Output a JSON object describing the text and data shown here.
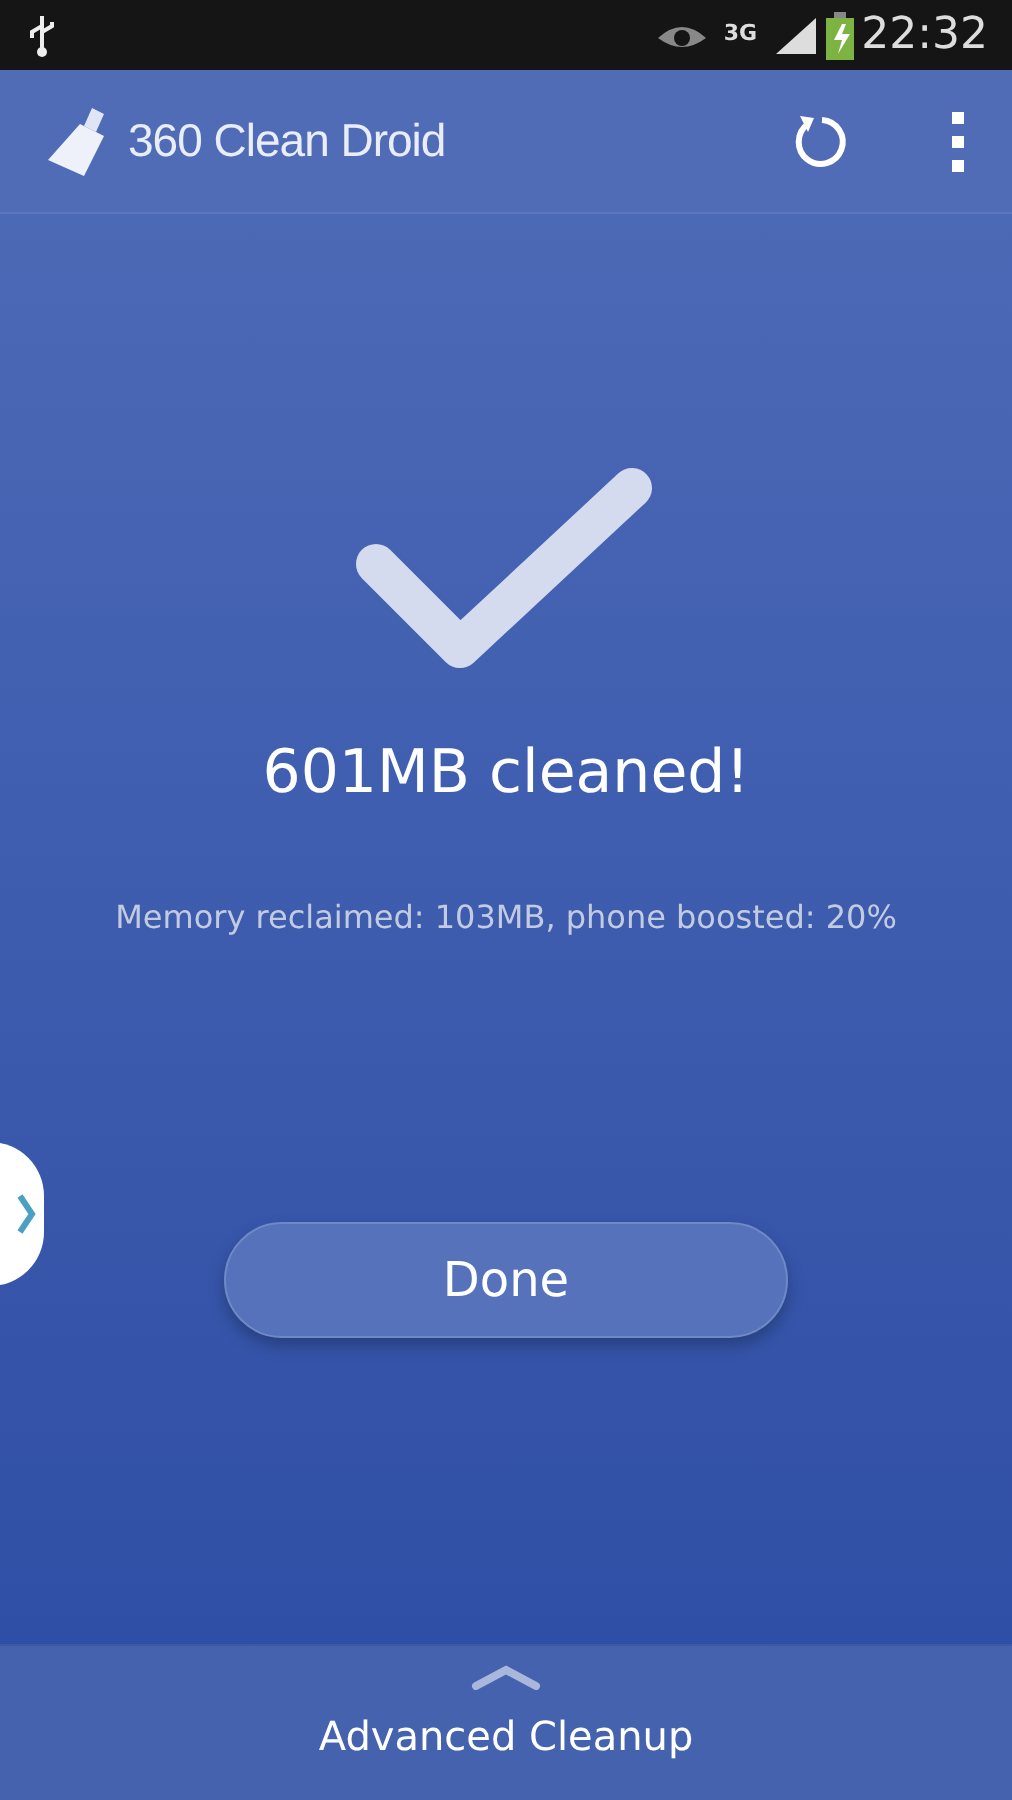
{
  "status_bar": {
    "network": "3G",
    "time": "22:32"
  },
  "app_bar": {
    "title": "360 Clean Droid"
  },
  "result": {
    "headline": "601MB cleaned!",
    "details": "Memory reclaimed: 103MB, phone boosted: 20%"
  },
  "done_button": {
    "label": "Done"
  },
  "bottom_panel": {
    "label": "Advanced Cleanup"
  }
}
